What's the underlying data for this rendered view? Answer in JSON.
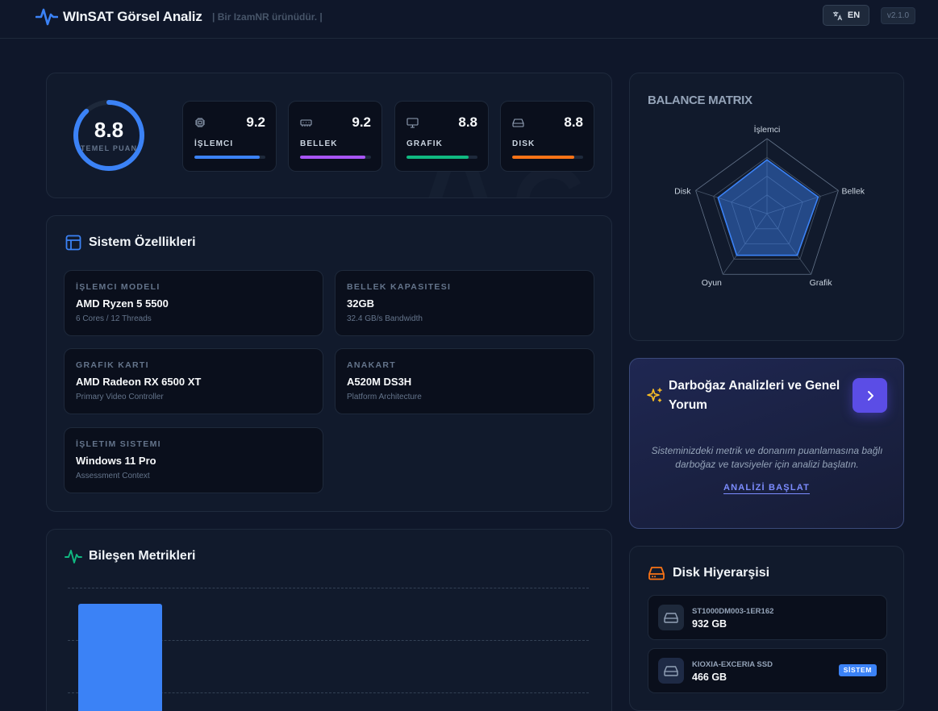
{
  "header": {
    "title": "WInSAT Görsel Analiz",
    "subtitle": "| Bir IzamNR ürünüdür. |",
    "lang_label": "EN",
    "version": "v2.1.0"
  },
  "score": {
    "value": "8.8",
    "label": "TEMEL PUAN",
    "fraction": 0.88
  },
  "metrics": [
    {
      "label": "İŞLEMCI",
      "value": "9.2",
      "fraction": 0.92,
      "color": "#3b82f6",
      "icon": "cpu-icon"
    },
    {
      "label": "BELLEK",
      "value": "9.2",
      "fraction": 0.92,
      "color": "#a855f7",
      "icon": "memory-icon"
    },
    {
      "label": "GRAFIK",
      "value": "8.8",
      "fraction": 0.88,
      "color": "#10b981",
      "icon": "monitor-icon"
    },
    {
      "label": "DISK",
      "value": "8.8",
      "fraction": 0.88,
      "color": "#f97316",
      "icon": "disk-icon"
    }
  ],
  "system": {
    "title": "Sistem Özellikleri",
    "specs": [
      {
        "label": "İŞLEMCI MODELI",
        "value": "AMD Ryzen 5 5500",
        "sub": "6 Cores / 12 Threads"
      },
      {
        "label": "BELLEK KAPASITESI",
        "value": "32GB",
        "sub": "32.4 GB/s Bandwidth"
      },
      {
        "label": "GRAFIK KARTI",
        "value": "AMD Radeon RX 6500 XT",
        "sub": "Primary Video Controller"
      },
      {
        "label": "ANAKART",
        "value": "A520M DS3H",
        "sub": "Platform Architecture"
      },
      {
        "label": "İŞLETIM SISTEMI",
        "value": "Windows 11 Pro",
        "sub": "Assessment Context"
      }
    ]
  },
  "component_metrics": {
    "title": "Bileşen Metrikleri"
  },
  "chart_data": {
    "type": "radar",
    "title": "BALANCE MATRIX",
    "axes": [
      "İşlemci",
      "Bellek",
      "Grafik",
      "Oyun",
      "Disk"
    ],
    "values": [
      9.2,
      9.2,
      8.8,
      8.8,
      8.8
    ],
    "range": [
      0,
      10
    ],
    "color": "#3b82f6"
  },
  "analysis": {
    "title": "Darboğaz Analizleri ve Genel Yorum",
    "description": "Sisteminizdeki metrik ve donanım puanlamasına bağlı darboğaz ve tavsiyeler için analizi başlatın.",
    "start_label": "ANALİZİ BAŞLAT"
  },
  "disks": {
    "title": "Disk Hiyerarşisi",
    "items": [
      {
        "name": "ST1000DM003-1ER162",
        "size": "932 GB",
        "badge": ""
      },
      {
        "name": "KIOXIA-EXCERIA SSD",
        "size": "466 GB",
        "badge": "SİSTEM"
      }
    ]
  }
}
